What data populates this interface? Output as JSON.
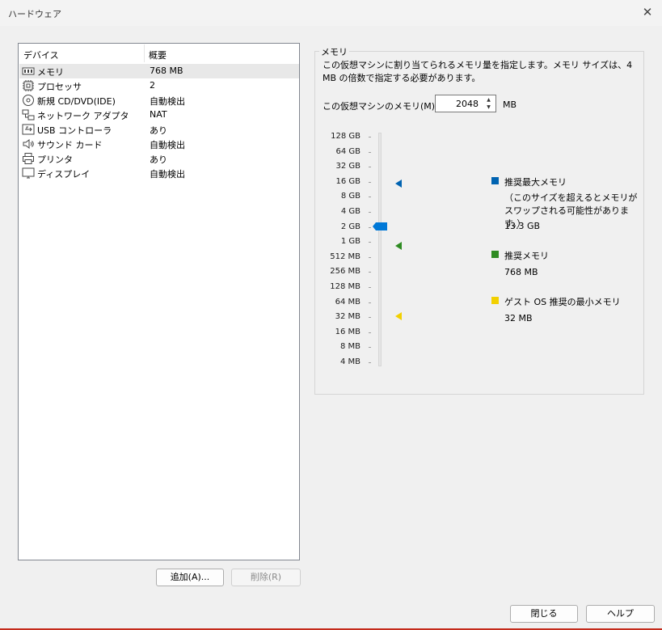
{
  "window": {
    "title": "ハードウェア"
  },
  "device_list": {
    "headers": {
      "device": "デバイス",
      "summary": "概要"
    },
    "rows": [
      {
        "name": "メモリ",
        "summary": "768 MB",
        "icon": "memory-icon"
      },
      {
        "name": "プロセッサ",
        "summary": "2",
        "icon": "processor-icon"
      },
      {
        "name": "新規 CD/DVD(IDE)",
        "summary": "自動検出",
        "icon": "cd-dvd-icon"
      },
      {
        "name": "ネットワーク アダプタ",
        "summary": "NAT",
        "icon": "network-adapter-icon"
      },
      {
        "name": "USB コントローラ",
        "summary": "あり",
        "icon": "usb-icon"
      },
      {
        "name": "サウンド カード",
        "summary": "自動検出",
        "icon": "speaker-icon"
      },
      {
        "name": "プリンタ",
        "summary": "あり",
        "icon": "printer-icon"
      },
      {
        "name": "ディスプレイ",
        "summary": "自動検出",
        "icon": "monitor-icon"
      }
    ],
    "selected_index": 0
  },
  "buttons": {
    "add": "追加(A)...",
    "remove": "削除(R)",
    "close": "閉じる",
    "help": "ヘルプ"
  },
  "memory": {
    "group_title": "メモリ",
    "description": "この仮想マシンに割り当てられるメモリ量を指定します。メモリ サイズは、4 MB の倍数で指定する必要があります。",
    "label": "この仮想マシンのメモリ(M):",
    "value": "2048",
    "unit": "MB",
    "scale": [
      "128 GB",
      "64 GB",
      "32 GB",
      "16 GB",
      "8 GB",
      "4 GB",
      "2 GB",
      "1 GB",
      "512 MB",
      "256 MB",
      "128 MB",
      "64 MB",
      "32 MB",
      "16 MB",
      "8 MB",
      "4 MB"
    ],
    "legend": {
      "max_title": "推奨最大メモリ",
      "max_note": "（このサイズを超えるとメモリがスワップされる可能性があります。）",
      "max_value": "13.3 GB",
      "rec_title": "推奨メモリ",
      "rec_value": "768 MB",
      "min_title": "ゲスト OS 推奨の最小メモリ",
      "min_value": "32 MB"
    },
    "colors": {
      "max": "#0063b1",
      "recommended": "#2e8b22",
      "min": "#f2d000",
      "thumb": "#0078d7"
    }
  }
}
